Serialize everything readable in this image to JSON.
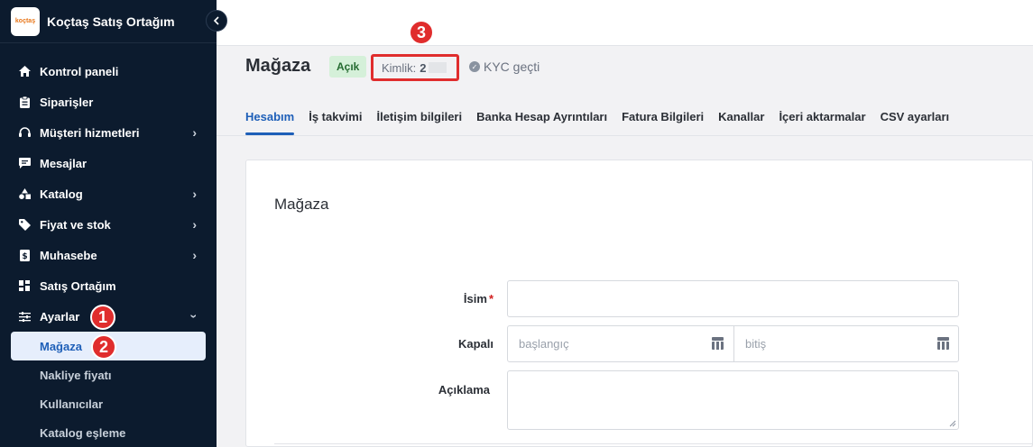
{
  "app": {
    "brand_logo_text": "koçtaş",
    "brand_title": "Koçtaş Satış Ortağım"
  },
  "sidebar": {
    "items": [
      {
        "label": "Kontrol paneli",
        "icon": "home-icon",
        "has_chevron": false
      },
      {
        "label": "Siparişler",
        "icon": "clipboard-icon",
        "has_chevron": false
      },
      {
        "label": "Müşteri hizmetleri",
        "icon": "headset-icon",
        "has_chevron": true
      },
      {
        "label": "Mesajlar",
        "icon": "message-icon",
        "has_chevron": false
      },
      {
        "label": "Katalog",
        "icon": "shapes-icon",
        "has_chevron": true
      },
      {
        "label": "Fiyat ve stok",
        "icon": "tag-icon",
        "has_chevron": true
      },
      {
        "label": "Muhasebe",
        "icon": "invoice-icon",
        "has_chevron": true
      },
      {
        "label": "Satış Ortağım",
        "icon": "grid-icon",
        "has_chevron": false
      },
      {
        "label": "Ayarlar",
        "icon": "sliders-icon",
        "has_chevron": true
      }
    ],
    "sub_items": [
      {
        "label": "Mağaza",
        "active": true
      },
      {
        "label": "Nakliye fiyatı",
        "active": false
      },
      {
        "label": "Kullanıcılar",
        "active": false
      },
      {
        "label": "Katalog eşleme",
        "active": false
      }
    ]
  },
  "steps": [
    "1",
    "2",
    "3"
  ],
  "header": {
    "title": "Mağaza",
    "status_badge": "Açık",
    "kimlik_label": "Kimlik:",
    "kimlik_value": "2",
    "kyc_label": "KYC geçti"
  },
  "tabs": [
    {
      "label": "Hesabım",
      "active": true
    },
    {
      "label": "İş takvimi",
      "active": false
    },
    {
      "label": "İletişim bilgileri",
      "active": false
    },
    {
      "label": "Banka Hesap Ayrıntıları",
      "active": false
    },
    {
      "label": "Fatura Bilgileri",
      "active": false
    },
    {
      "label": "Kanallar",
      "active": false
    },
    {
      "label": "İçeri aktarmalar",
      "active": false
    },
    {
      "label": "CSV ayarları",
      "active": false
    }
  ],
  "form": {
    "section_title": "Mağaza",
    "name_label": "İsim",
    "name_required_mark": "*",
    "name_value": "",
    "closed_label": "Kapalı",
    "start_placeholder": "başlangıç",
    "end_placeholder": "bitiş",
    "description_label": "Açıklama",
    "description_value": ""
  },
  "colors": {
    "sidebar_bg": "#0c1b2e",
    "accent": "#1e5fb8",
    "step_marker": "#e02d2d",
    "badge_open_bg": "#d5f0d9"
  }
}
